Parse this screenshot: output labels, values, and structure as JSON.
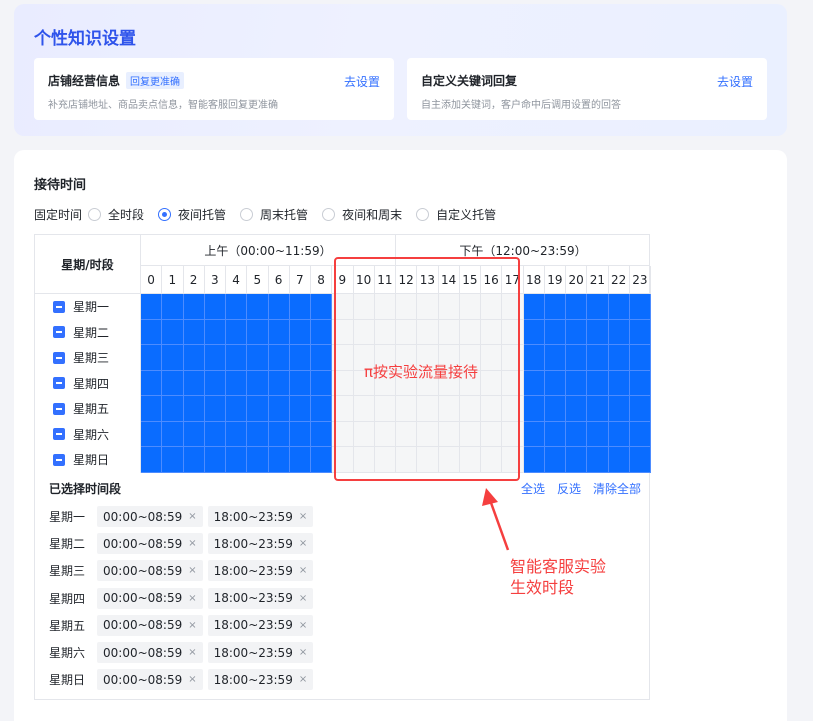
{
  "top_card": {
    "title": "个性知识设置",
    "store_info": {
      "title": "店铺经营信息",
      "tag": "回复更准确",
      "desc": "补充店铺地址、商品卖点信息，智能客服回复更准确",
      "link": "去设置"
    },
    "custom_keyword": {
      "title": "自定义关键词回复",
      "desc": "自主添加关键词，客户命中后调用设置的回答",
      "link": "去设置"
    }
  },
  "reception": {
    "title": "接待时间",
    "mode_label": "固定时间",
    "modes": [
      {
        "label": "全时段",
        "checked": false
      },
      {
        "label": "夜间托管",
        "checked": true
      },
      {
        "label": "周末托管",
        "checked": false
      },
      {
        "label": "夜间和周末",
        "checked": false
      },
      {
        "label": "自定义托管",
        "checked": false
      }
    ],
    "grid": {
      "corner_label": "星期/时段",
      "am_label": "上午（00:00~11:59）",
      "pm_label": "下午（12:00~23:59）",
      "hours": [
        "0",
        "1",
        "2",
        "3",
        "4",
        "5",
        "6",
        "7",
        "8",
        "9",
        "10",
        "11",
        "12",
        "13",
        "14",
        "15",
        "16",
        "17",
        "18",
        "19",
        "20",
        "21",
        "22",
        "23"
      ],
      "days": [
        "星期一",
        "星期二",
        "星期三",
        "星期四",
        "星期五",
        "星期六",
        "星期日"
      ],
      "selected_hours": [
        0,
        1,
        2,
        3,
        4,
        5,
        6,
        7,
        8,
        18,
        19,
        20,
        21,
        22,
        23
      ]
    },
    "selected": {
      "title": "已选择时间段",
      "actions": {
        "select_all": "全选",
        "invert": "反选",
        "clear_all": "清除全部"
      },
      "rows": [
        {
          "day": "星期一",
          "ranges": [
            "00:00~08:59",
            "18:00~23:59"
          ]
        },
        {
          "day": "星期二",
          "ranges": [
            "00:00~08:59",
            "18:00~23:59"
          ]
        },
        {
          "day": "星期三",
          "ranges": [
            "00:00~08:59",
            "18:00~23:59"
          ]
        },
        {
          "day": "星期四",
          "ranges": [
            "00:00~08:59",
            "18:00~23:59"
          ]
        },
        {
          "day": "星期五",
          "ranges": [
            "00:00~08:59",
            "18:00~23:59"
          ]
        },
        {
          "day": "星期六",
          "ranges": [
            "00:00~08:59",
            "18:00~23:59"
          ]
        },
        {
          "day": "星期日",
          "ranges": [
            "00:00~08:59",
            "18:00~23:59"
          ]
        }
      ]
    }
  },
  "annotations": {
    "box_label": "π按实验流量接待",
    "note_line1": "智能客服实验",
    "note_line2": "生效时段",
    "color": "#f53f3f"
  }
}
